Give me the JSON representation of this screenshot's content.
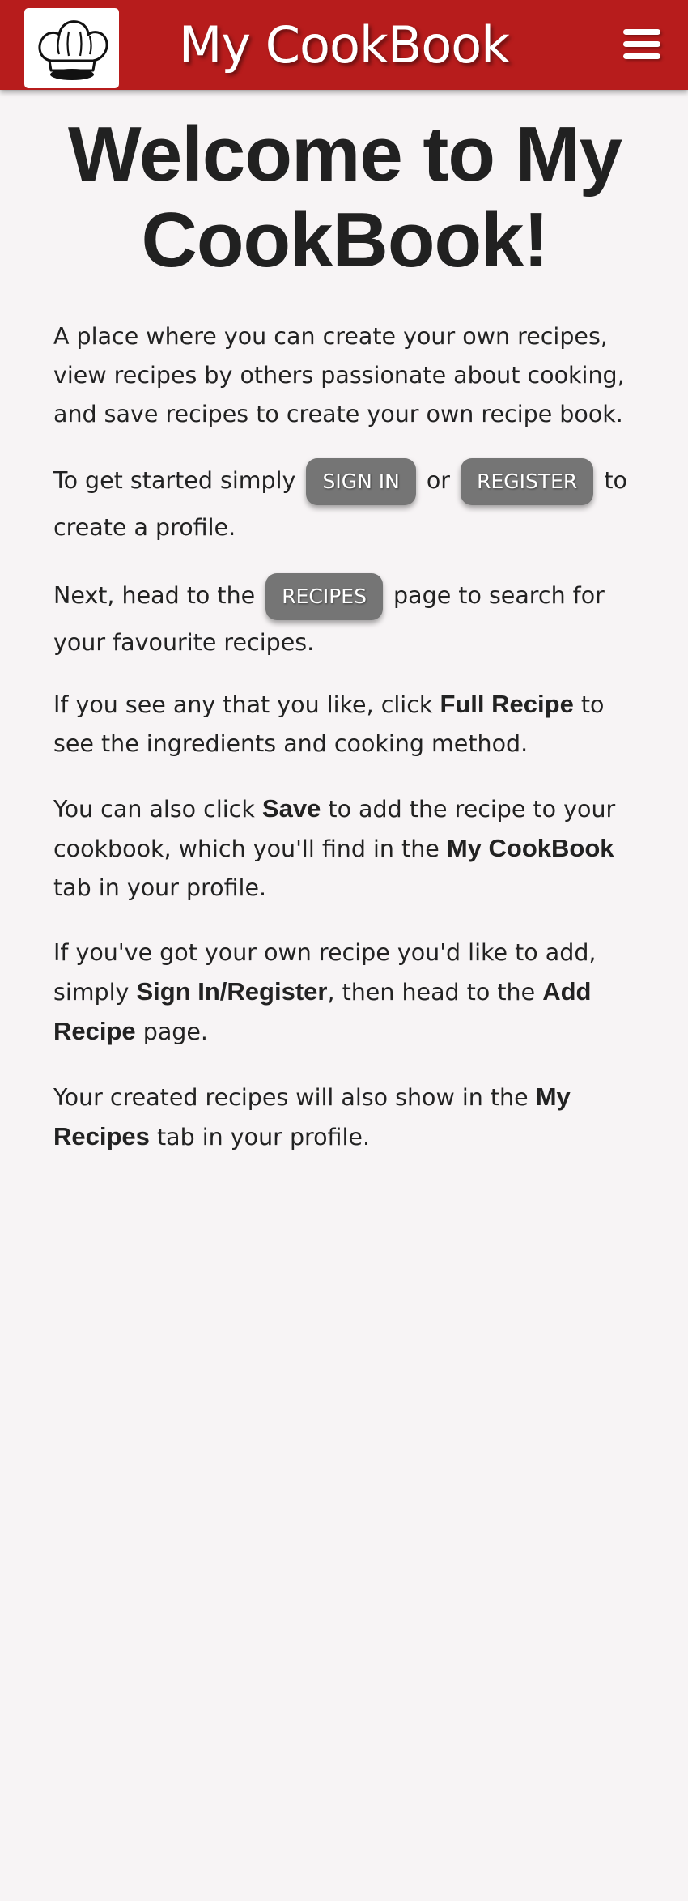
{
  "header": {
    "brand": "My CookBook",
    "logo_icon": "chef-hat-icon",
    "menu_icon": "hamburger-menu-icon",
    "background_color": "#b71c1c"
  },
  "main": {
    "title": "Welcome to My CookBook!",
    "intro": "A place where you can create your own recipes, view recipes by others passionate about cooking, and save recipes to create your own recipe book.",
    "get_started": {
      "before": "To get started simply",
      "sign_in": "SIGN IN",
      "or": "or",
      "register": "REGISTER",
      "after": "to create a profile."
    },
    "next": {
      "before": "Next, head to the",
      "recipes": "RECIPES",
      "after": "page to search for your favourite recipes."
    },
    "full_recipe": {
      "before": "If you see any that you like, click",
      "bold": "Full Recipe",
      "after": "to see the ingredients and cooking method."
    },
    "save": {
      "before": "You can also click",
      "bold1": "Save",
      "middle": "to add the recipe to your cookbook, which you'll find in the",
      "bold2": "My CookBook",
      "after": "tab in your profile."
    },
    "own_recipe": {
      "before": "If you've got your own recipe you'd like to add, simply",
      "bold1": "Sign In/Register",
      "middle": ", then head to the",
      "bold2": "Add Recipe",
      "after": "page."
    },
    "created": {
      "before": "Your created recipes will also show in the",
      "bold": "My Recipes",
      "after": "tab in your profile."
    },
    "button_color": "#757575"
  }
}
